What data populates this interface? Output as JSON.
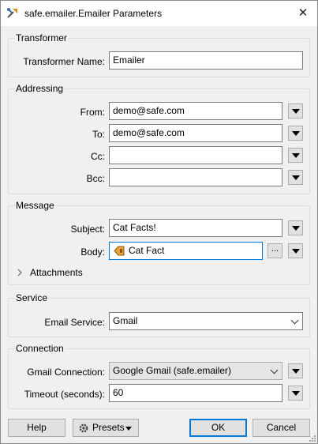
{
  "window": {
    "title": "safe.emailer.Emailer Parameters",
    "close_glyph": "✕"
  },
  "transformer": {
    "group_title": "Transformer",
    "name_label": "Transformer Name:",
    "name_value": "Emailer"
  },
  "addressing": {
    "group_title": "Addressing",
    "from_label": "From:",
    "from_value": "demo@safe.com",
    "to_label": "To:",
    "to_value": "demo@safe.com",
    "cc_label": "Cc:",
    "cc_value": "",
    "bcc_label": "Bcc:",
    "bcc_value": ""
  },
  "message": {
    "group_title": "Message",
    "subject_label": "Subject:",
    "subject_value": "Cat Facts!",
    "body_label": "Body:",
    "body_value": "Cat Fact",
    "body_ellipsis": "...",
    "attachments_label": "Attachments"
  },
  "service": {
    "group_title": "Service",
    "email_service_label": "Email Service:",
    "email_service_value": "Gmail"
  },
  "connection": {
    "group_title": "Connection",
    "gmail_connection_label": "Gmail Connection:",
    "gmail_connection_value": "Google Gmail (safe.emailer)",
    "timeout_label": "Timeout (seconds):",
    "timeout_value": "60"
  },
  "buttons": {
    "help": "Help",
    "presets": "Presets",
    "ok": "OK",
    "cancel": "Cancel"
  },
  "colors": {
    "focus_border": "#0078d7",
    "attribute_icon": "#e8a33a",
    "app_icon_accent": "#d98a1c"
  }
}
